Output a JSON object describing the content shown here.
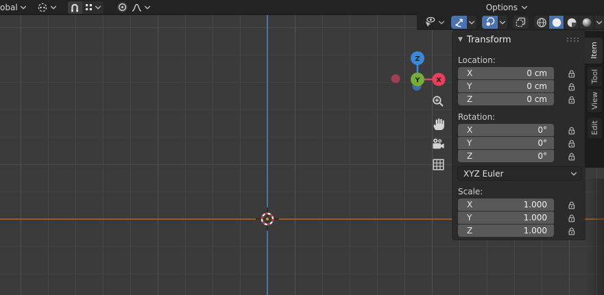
{
  "topbar": {
    "transform_orientation_label": "obal",
    "options_label": "Options"
  },
  "viewport_header_right": {
    "buttons": [
      {
        "name": "object-type-visibility",
        "active": false
      },
      {
        "name": "show-gizmos",
        "active": true
      },
      {
        "name": "show-overlays",
        "active": true
      },
      {
        "name": "toggle-xray",
        "active": false
      },
      {
        "name": "shading-wireframe",
        "active": false
      },
      {
        "name": "shading-solid",
        "active": true
      },
      {
        "name": "shading-material-preview",
        "active": false
      },
      {
        "name": "shading-rendered",
        "active": false
      }
    ]
  },
  "viewport": {
    "axis_gizmo": {
      "x_label": "X",
      "y_label": "Y",
      "z_label": "Z"
    },
    "nav_buttons": [
      "zoom",
      "pan",
      "camera-view",
      "toggle-orthographic"
    ]
  },
  "transform_panel": {
    "title": "Transform",
    "location": {
      "label": "Location:",
      "rows": [
        {
          "axis": "X",
          "value": "0 cm"
        },
        {
          "axis": "Y",
          "value": "0 cm"
        },
        {
          "axis": "Z",
          "value": "0 cm"
        }
      ]
    },
    "rotation": {
      "label": "Rotation:",
      "rows": [
        {
          "axis": "X",
          "value": "0°"
        },
        {
          "axis": "Y",
          "value": "0°"
        },
        {
          "axis": "Z",
          "value": "0°"
        }
      ]
    },
    "rotation_mode": "XYZ Euler",
    "scale": {
      "label": "Scale:",
      "rows": [
        {
          "axis": "X",
          "value": "1.000"
        },
        {
          "axis": "Y",
          "value": "1.000"
        },
        {
          "axis": "Z",
          "value": "1.000"
        }
      ]
    }
  },
  "sidebar_tabs": [
    {
      "label": "Item",
      "active": true
    },
    {
      "label": "Tool",
      "active": false
    },
    {
      "label": "View",
      "active": false
    },
    {
      "label": "Edit",
      "active": false
    }
  ],
  "colors": {
    "accent_blue": "#4a72b0",
    "viewport_bg": "#3b3b3b",
    "axis_x_line": "#b06d30",
    "axis_z_line": "#4e7496",
    "gizmo_x": "#e93f5f",
    "gizmo_y": "#76ad36",
    "gizmo_z": "#3e86d8",
    "gizmo_neg_x": "#a23e52",
    "gizmo_neg_z": "#3d6da3"
  }
}
